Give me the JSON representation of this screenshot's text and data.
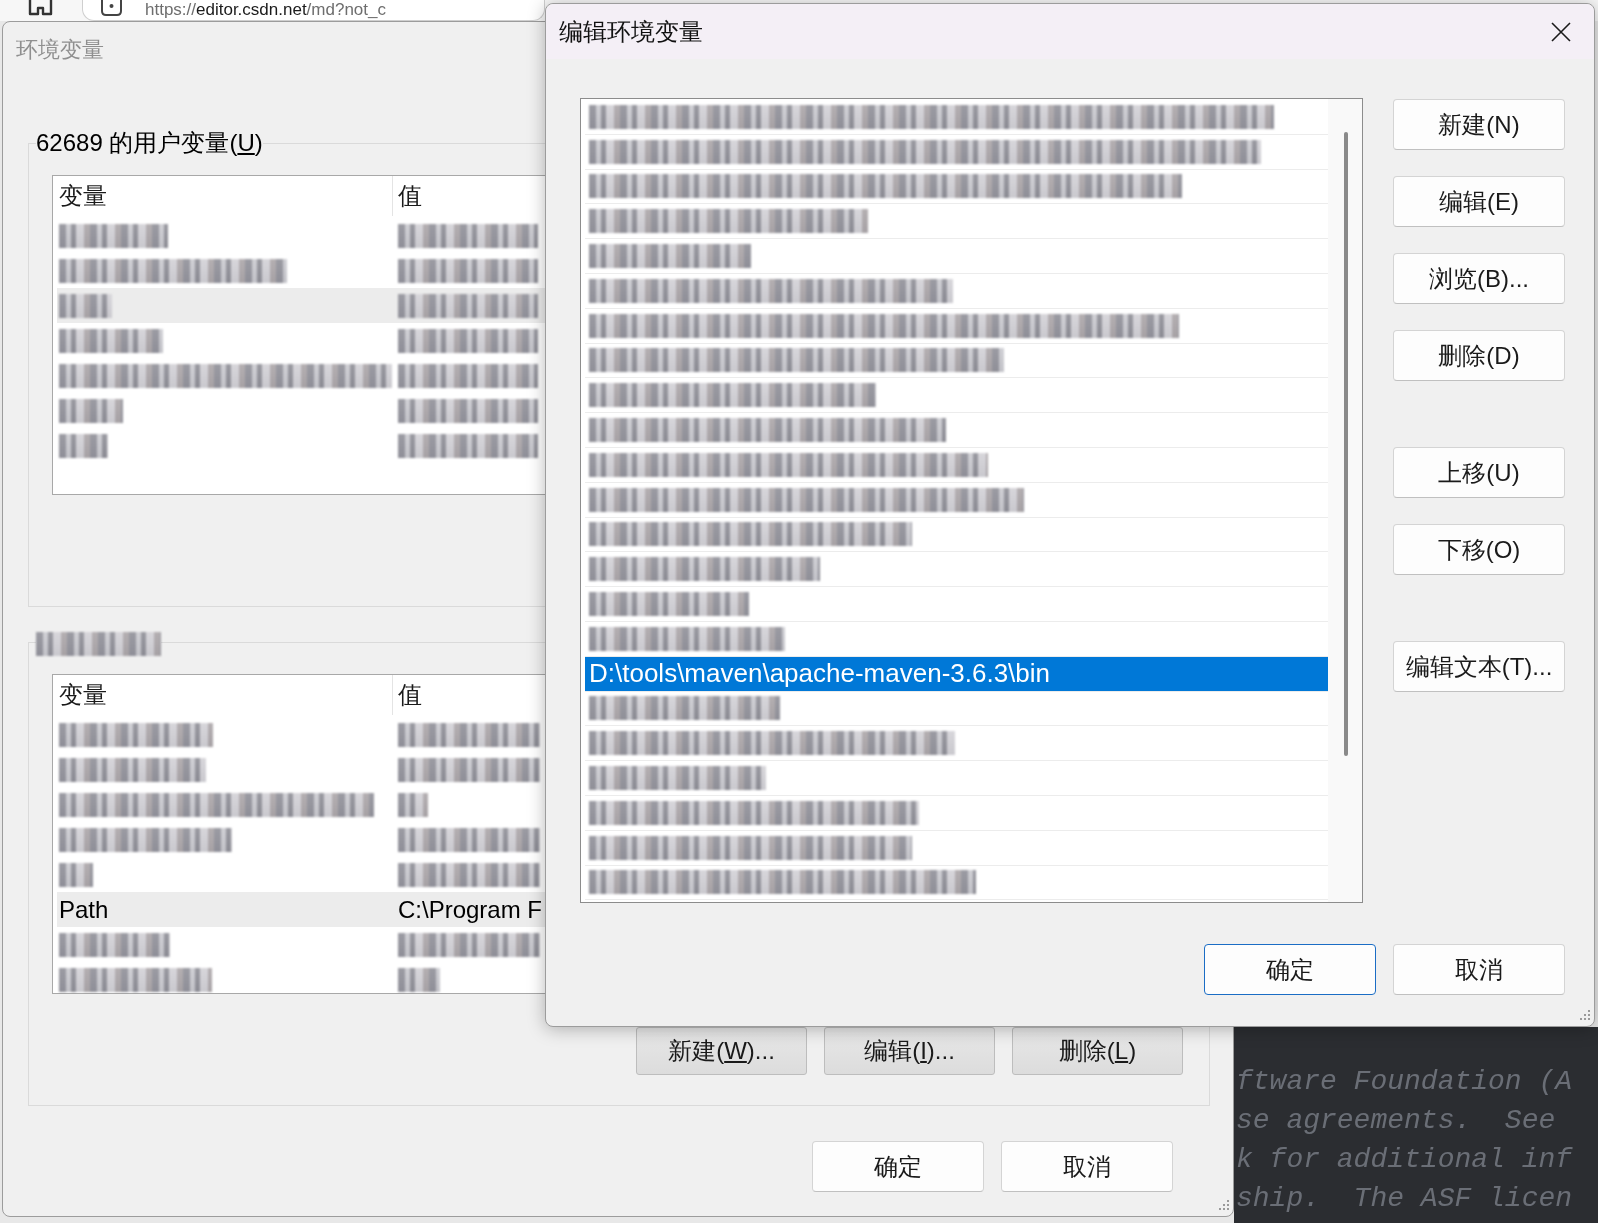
{
  "browser": {
    "url": {
      "scheme": "https://",
      "host": "editor.csdn.net",
      "path": "/md?not_c"
    }
  },
  "env_dialog": {
    "title": "环境变量",
    "groups": [
      {
        "title": {
          "kind": "text",
          "before": "62689 的用户变量(",
          "key": "U",
          "after": ")"
        },
        "columns": [
          "变量",
          "值"
        ],
        "rows": [
          {
            "kind": "blurred",
            "selected": false
          },
          {
            "kind": "blurred",
            "selected": false
          },
          {
            "kind": "blurred",
            "selected": true
          },
          {
            "kind": "blurred",
            "selected": false
          },
          {
            "kind": "blurred",
            "selected": false
          },
          {
            "kind": "blurred",
            "selected": false
          },
          {
            "kind": "blurred",
            "selected": false
          }
        ]
      },
      {
        "title": {
          "kind": "blurred"
        },
        "columns": [
          "变量",
          "值"
        ],
        "rows": [
          {
            "kind": "blurred",
            "selected": false
          },
          {
            "kind": "blurred",
            "selected": false
          },
          {
            "kind": "blurred",
            "selected": false
          },
          {
            "kind": "blurred",
            "selected": false
          },
          {
            "kind": "blurred",
            "selected": false
          },
          {
            "kind": "text",
            "name": "Path",
            "value": "C:\\Program F",
            "selected": true
          },
          {
            "kind": "blurred",
            "selected": false
          },
          {
            "kind": "blurred",
            "selected": false
          }
        ],
        "buttons": [
          {
            "before": "新建(",
            "key": "W",
            "after": ")..."
          },
          {
            "before": "编辑(",
            "key": "I",
            "after": ")..."
          },
          {
            "before": "删除(",
            "key": "L",
            "after": ")"
          }
        ]
      }
    ],
    "buttons": [
      "确定",
      "取消"
    ]
  },
  "edit_dialog": {
    "title": "编辑环境变量",
    "entries": [
      {
        "kind": "blurred",
        "selected": false
      },
      {
        "kind": "blurred",
        "selected": false
      },
      {
        "kind": "blurred",
        "selected": false
      },
      {
        "kind": "blurred",
        "selected": false
      },
      {
        "kind": "blurred",
        "selected": false
      },
      {
        "kind": "blurred",
        "selected": false
      },
      {
        "kind": "blurred",
        "selected": false
      },
      {
        "kind": "blurred",
        "selected": false
      },
      {
        "kind": "blurred",
        "selected": false
      },
      {
        "kind": "blurred",
        "selected": false
      },
      {
        "kind": "blurred",
        "selected": false
      },
      {
        "kind": "blurred",
        "selected": false
      },
      {
        "kind": "blurred",
        "selected": false
      },
      {
        "kind": "blurred",
        "selected": false
      },
      {
        "kind": "blurred",
        "selected": false
      },
      {
        "kind": "blurred",
        "selected": false
      },
      {
        "kind": "text",
        "text": "D:\\tools\\maven\\apache-maven-3.6.3\\bin",
        "selected": true
      },
      {
        "kind": "blurred",
        "selected": false
      },
      {
        "kind": "blurred",
        "selected": false
      },
      {
        "kind": "blurred",
        "selected": false
      },
      {
        "kind": "blurred",
        "selected": false
      },
      {
        "kind": "blurred",
        "selected": false
      },
      {
        "kind": "blurred",
        "selected": false
      }
    ],
    "button_groups": [
      [
        "新建(N)",
        "编辑(E)",
        "浏览(B)...",
        "删除(D)"
      ],
      [
        "上移(U)",
        "下移(O)"
      ],
      [
        "编辑文本(T)..."
      ]
    ],
    "buttons": [
      {
        "label": "确定",
        "default": true
      },
      {
        "label": "取消",
        "default": false
      }
    ]
  },
  "editor_background": {
    "lines": [
      "ftware Foundation (A",
      "se agreements.  See",
      "k for additional inf",
      "ship.  The ASF licen"
    ]
  }
}
